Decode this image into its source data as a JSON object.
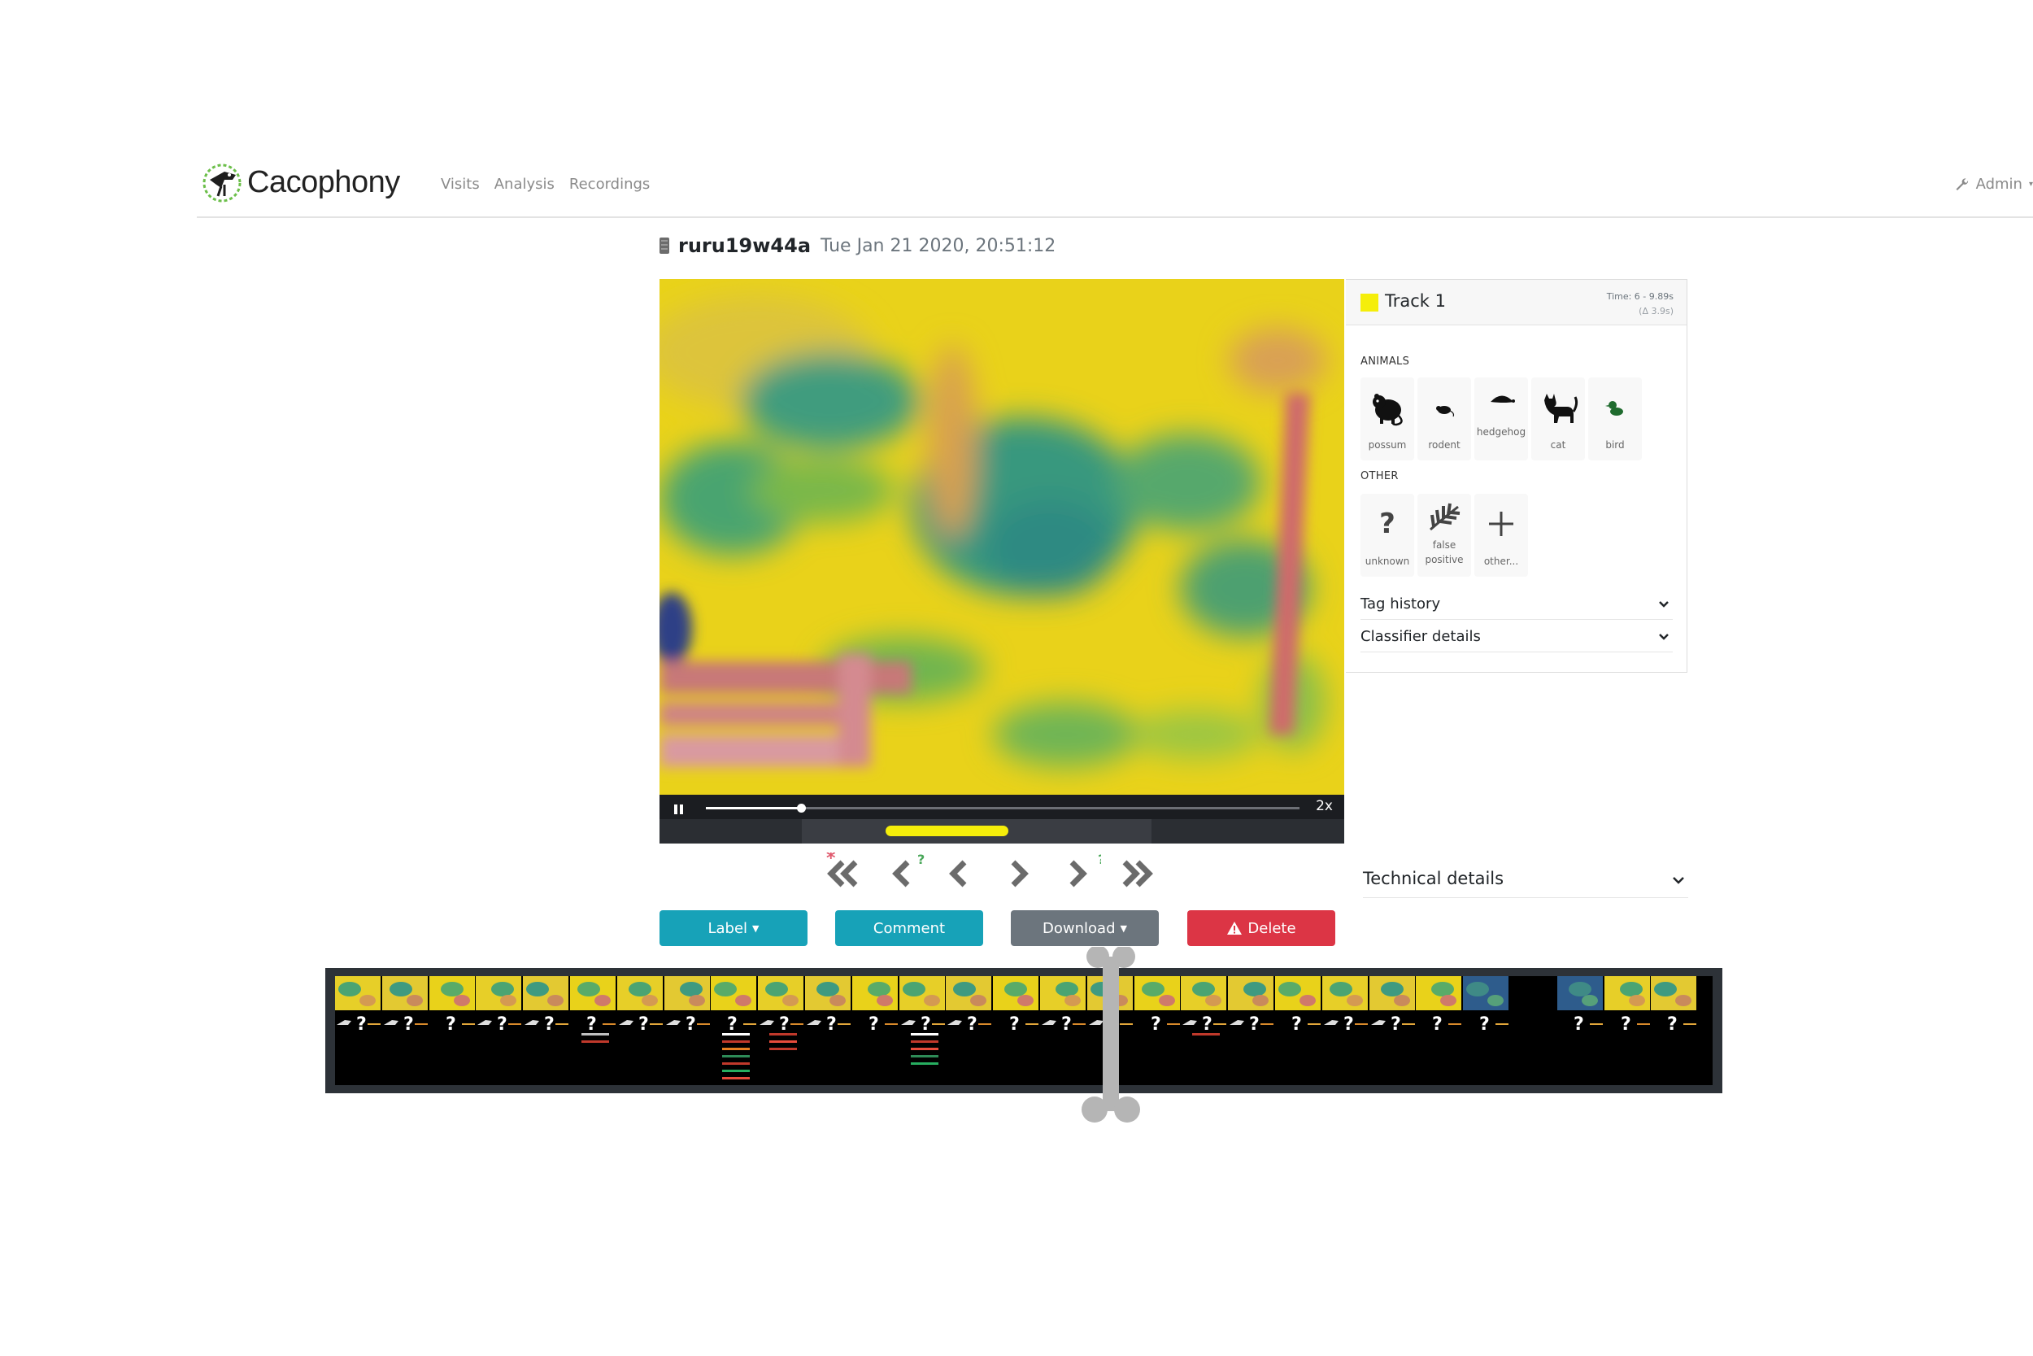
{
  "navbar": {
    "brand": "Cacophony",
    "links": [
      "Visits",
      "Analysis",
      "Recordings"
    ],
    "admin": "Admin"
  },
  "recording": {
    "device": "ruru19w44a",
    "datetime": "Tue Jan 21 2020, 20:51:12"
  },
  "player": {
    "speed": "2x",
    "progress_fraction": 0.16,
    "track_bar_fraction_start": 0.33,
    "track_bar_fraction_end": 0.51
  },
  "nav_arrows": [
    {
      "name": "prev-recording-untagged",
      "marker": "*",
      "marker_color": "#e05a6e"
    },
    {
      "name": "prev-recording-unknown",
      "marker": "?",
      "marker_color": "#4aa75a"
    },
    {
      "name": "prev-recording",
      "marker": "",
      "marker_color": ""
    },
    {
      "name": "next-recording",
      "marker": "",
      "marker_color": ""
    },
    {
      "name": "next-recording-unknown",
      "marker": "?",
      "marker_color": "#4aa75a"
    },
    {
      "name": "next-recording-untagged",
      "marker": "*",
      "marker_color": "#e05a6e"
    }
  ],
  "actions": {
    "label": "Label",
    "comment": "Comment",
    "download": "Download",
    "delete": "Delete"
  },
  "track": {
    "title": "Track 1",
    "color": "#f5ee0a",
    "time": "Time: 6 - 9.89s",
    "delta": "(Δ 3.9s)",
    "animals_heading": "ANIMALS",
    "animals": [
      {
        "label": "possum",
        "icon": "possum-icon"
      },
      {
        "label": "rodent",
        "icon": "rodent-icon"
      },
      {
        "label": "hedgehog",
        "icon": "hedgehog-icon"
      },
      {
        "label": "cat",
        "icon": "cat-icon"
      },
      {
        "label": "bird",
        "icon": "bird-icon"
      }
    ],
    "other_heading": "OTHER",
    "other": [
      {
        "label": "unknown",
        "icon": "question-icon"
      },
      {
        "label": "false positive",
        "icon": "fern-icon"
      },
      {
        "label": "other...",
        "icon": "plus-icon"
      }
    ],
    "tag_history": "Tag history",
    "classifier_details": "Classifier details"
  },
  "technical_details": "Technical details",
  "colors": {
    "teal": "#17a2b8",
    "grey": "#6c757d",
    "red": "#dc3545",
    "track_yellow": "#f5ee0a"
  }
}
